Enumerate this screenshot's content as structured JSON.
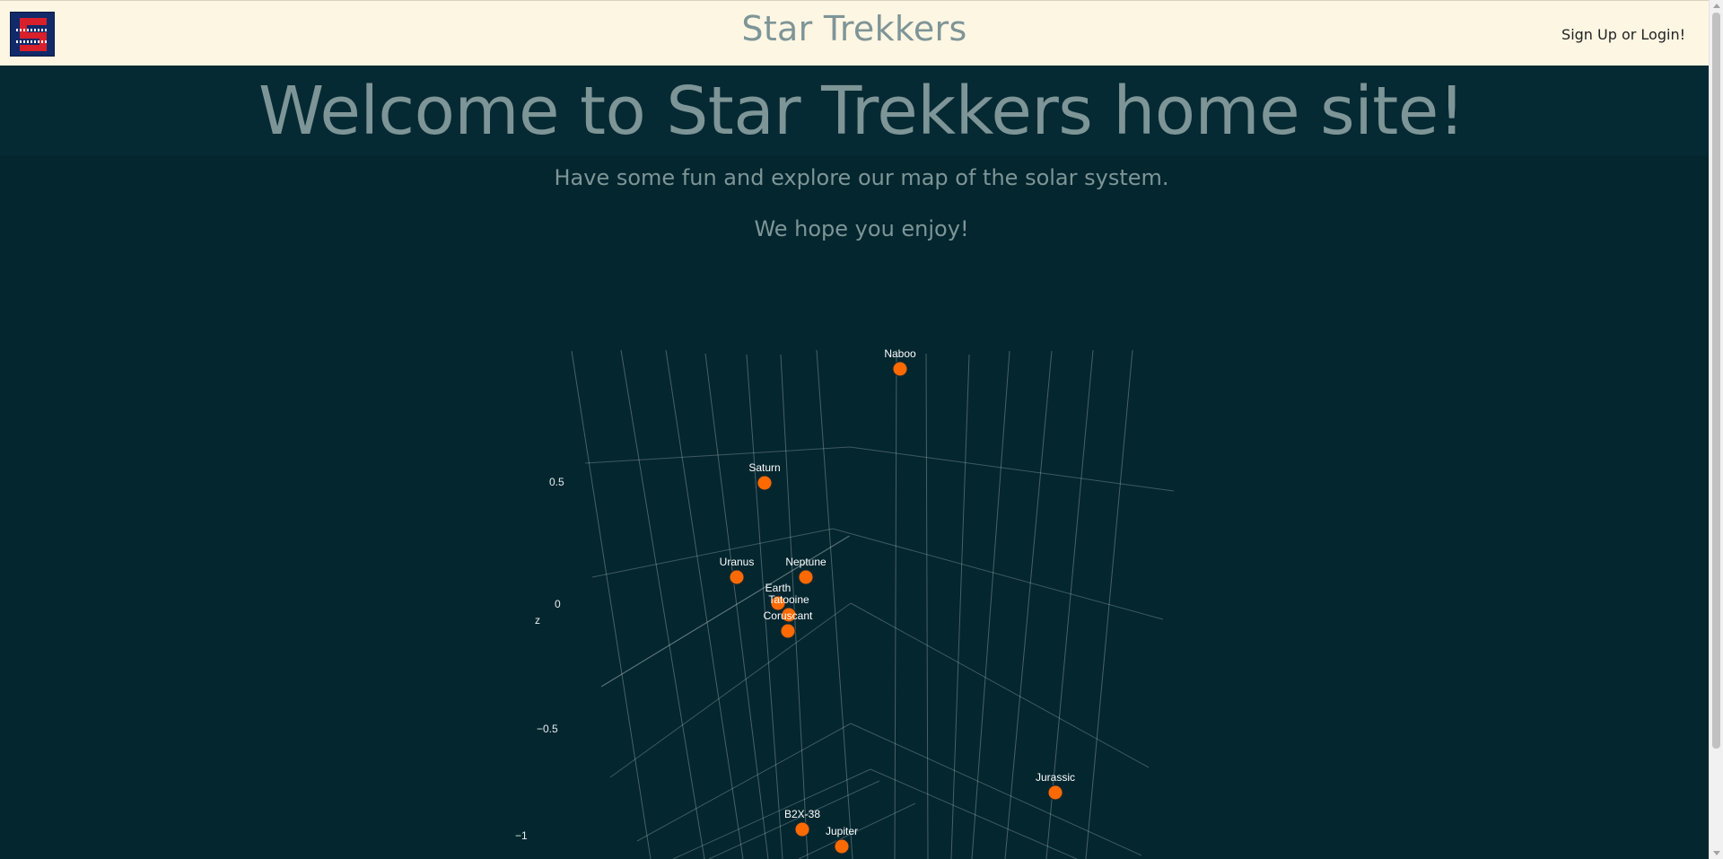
{
  "navbar": {
    "brand": "Star Trekkers",
    "login_label": "Sign Up or Login!"
  },
  "hero": {
    "title": "Welcome to Star Trekkers home site!",
    "subtitle": "Have some fun and explore our map of the solar system.",
    "enjoy": "We hope you enjoy!"
  },
  "colors": {
    "background": "#03262f",
    "navbar": "#fdf6e3",
    "text_muted": "#7e9597",
    "marker": "#ff6a00"
  },
  "chart_data": {
    "type": "scatter3d",
    "zlabel": "z",
    "ztick_labels": [
      "0.5",
      "0",
      "−0.5",
      "−1"
    ],
    "points": [
      {
        "name": "Naboo",
        "z": 0.97
      },
      {
        "name": "Saturn",
        "z": 0.5
      },
      {
        "name": "Uranus",
        "z": 0.13
      },
      {
        "name": "Neptune",
        "z": 0.13
      },
      {
        "name": "Earth",
        "z": 0.02
      },
      {
        "name": "Tatooine",
        "z": -0.01
      },
      {
        "name": "Coruscant",
        "z": -0.05
      },
      {
        "name": "Jurassic",
        "z": -0.72
      },
      {
        "name": "B2X-38",
        "z": -0.86
      },
      {
        "name": "Jupiter",
        "z": -0.93
      }
    ]
  }
}
